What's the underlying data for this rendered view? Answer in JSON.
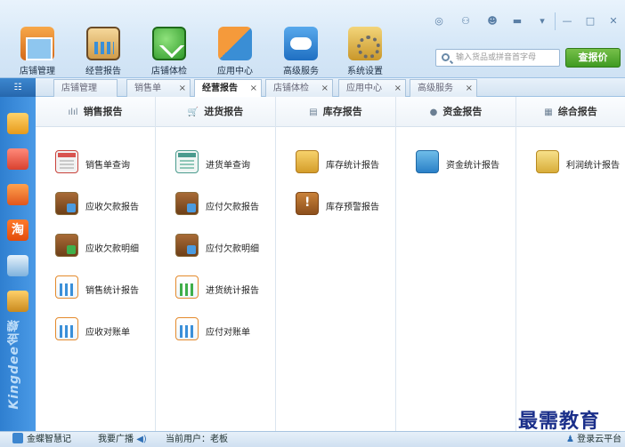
{
  "toolbar": [
    {
      "label": "店铺管理",
      "icon": "storefront-icon"
    },
    {
      "label": "经营报告",
      "icon": "report-clipboard-icon"
    },
    {
      "label": "店铺体检",
      "icon": "checkmark-circle-icon"
    },
    {
      "label": "应用中心",
      "icon": "app-center-icon"
    },
    {
      "label": "高级服务",
      "icon": "cloud-icon"
    },
    {
      "label": "系统设置",
      "icon": "gear-box-icon"
    }
  ],
  "window_controls": [
    "◎",
    "⚇",
    "☻",
    "▬",
    "▾",
    "—",
    "□",
    "✕"
  ],
  "search": {
    "placeholder": "输入货品或拼音首字母"
  },
  "price_button": "查报价",
  "tabs": [
    {
      "label": "店铺管理",
      "close": ""
    },
    {
      "label": "销售单",
      "close": "×"
    },
    {
      "label": "经营报告",
      "close": "×"
    },
    {
      "label": "店铺体检",
      "close": "×"
    },
    {
      "label": "应用中心",
      "close": "×"
    },
    {
      "label": "高级服务",
      "close": "×"
    }
  ],
  "left_grid_button": "☷",
  "brand": "Kingdee金蝶",
  "columns": [
    {
      "title": "销售报告",
      "icon_glyph": "ılıl",
      "items": [
        "销售单查询",
        "应收欠款报告",
        "应收欠款明细",
        "销售统计报告",
        "应收对账单"
      ]
    },
    {
      "title": "进货报告",
      "icon_glyph": "🛒",
      "items": [
        "进货单查询",
        "应付欠款报告",
        "应付欠款明细",
        "进货统计报告",
        "应付对账单"
      ]
    },
    {
      "title": "库存报告",
      "icon_glyph": "▤",
      "items": [
        "库存统计报告",
        "库存预警报告"
      ]
    },
    {
      "title": "资金报告",
      "icon_glyph": "●",
      "items": [
        "资金统计报告"
      ]
    },
    {
      "title": "综合报告",
      "icon_glyph": "▦",
      "items": [
        "利润统计报告"
      ]
    }
  ],
  "status": {
    "app_name": "金蝶智慧记",
    "broadcast": "我要广播",
    "broadcast_icon": "◀)",
    "current_user": "当前用户：老板",
    "login_cloud": "登录云平台"
  },
  "watermark": "最需教育"
}
